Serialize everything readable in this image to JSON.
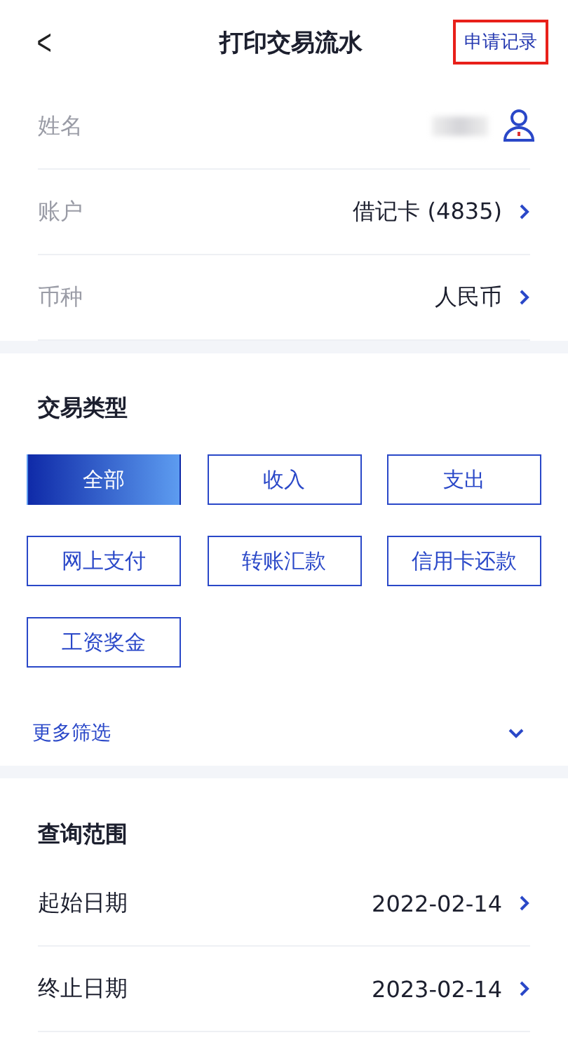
{
  "header": {
    "back": "<",
    "title": "打印交易流水",
    "link": {
      "label": "申请记录",
      "highlighted": true
    }
  },
  "info_rows": [
    {
      "kind": "name",
      "label": "姓名",
      "blurred": true
    },
    {
      "kind": "select",
      "label": "账户",
      "value": "借记卡 (4835)"
    },
    {
      "kind": "select",
      "label": "币种",
      "value": "人民币"
    }
  ],
  "transaction_type": {
    "title": "交易类型",
    "options": [
      {
        "label": "全部",
        "selected": true
      },
      {
        "label": "收入",
        "selected": false
      },
      {
        "label": "支出",
        "selected": false
      },
      {
        "label": "网上支付",
        "selected": false
      },
      {
        "label": "转账汇款",
        "selected": false
      },
      {
        "label": "信用卡还款",
        "selected": false
      },
      {
        "label": "工资奖金",
        "selected": false
      }
    ],
    "more_filters": {
      "label": "更多筛选",
      "expanded": false
    }
  },
  "query_range": {
    "title": "查询范围",
    "rows": [
      {
        "label": "起始日期",
        "value": "2022-02-14"
      },
      {
        "label": "终止日期",
        "value": "2023-02-14"
      }
    ]
  }
}
